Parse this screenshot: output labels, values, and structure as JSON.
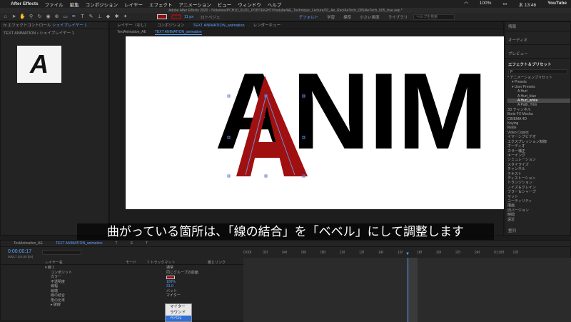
{
  "mac_menu": {
    "app": "After Effects",
    "items": [
      "ファイル",
      "編集",
      "コンポジション",
      "レイヤー",
      "エフェクト",
      "アニメーション",
      "ビュー",
      "ウィンドウ",
      "ヘルプ"
    ],
    "status": {
      "battery": "100%",
      "time": "木 13:46",
      "youtube": "YouTube"
    }
  },
  "window_title": "Adobe After Effects 2020 - /Volumes/PCH10_01/01_POBTEIGHT/Youtube/AE_Technique_Lecture/01_Ae_Rec/AeTech_005/AeTech_005_true.aep *",
  "toolbar": {
    "stroke_width": "11 px",
    "rotobrush_label": "ロトベジェ",
    "workspaces": [
      "デフォルト",
      "学習",
      "標準",
      "小さい画面",
      "ライブラリ"
    ],
    "active_workspace": "デフォルト",
    "search_placeholder": "ヘルプを検索"
  },
  "effect_controls": {
    "tab": "fx エフェクトコントロール",
    "tab_layer": "シェイプレイヤー 1",
    "subtitle": "TEXT ANIMATION • シェイプレイヤー 1",
    "thumb_letter": "A"
  },
  "comp_panel": {
    "tab_layer": "レイヤー（なし）",
    "tab_comp": "コンポジション",
    "comp_name": "TEXT ANIMATION_animation",
    "tab_render": "レンダーキュー",
    "subtab": "TextAnimation_AE",
    "subtab_active": "TEXT ANIMATION_animation",
    "canvas_text": "ANIM",
    "canvas_letter": "A"
  },
  "right_panel": {
    "sections": [
      "情報",
      "オーディオ",
      "プレビュー"
    ],
    "effects_header": "エフェクト＆プリセット",
    "search_value": "ρ",
    "tree": [
      "* アニメーションプリセット",
      "▾ Presets",
      "▾ User Presets",
      "A  Hurt",
      "A  Hurt_blue",
      "A  Hurt_white",
      "A  Path_Trim",
      "3D チャンネル",
      "Boris FX Mocha",
      "CINEMA 4D",
      "Keying",
      "Matte",
      "Video Copilot",
      "イマーシブビデオ",
      "エクスプレッション制御",
      "オーディオ",
      "カラー補正",
      "キーイング",
      "シミュレーション",
      "スタイライズ",
      "チャンネル",
      "テキスト",
      "ディストーション",
      "トランジション",
      "ノイズ＆グレイン",
      "ブラー＆シャープ",
      "マット",
      "ユーティリティ",
      "描画",
      "旧バージョン",
      "時間",
      "遠近"
    ],
    "selected_index": 5,
    "bottom_label": "整列"
  },
  "subtitle": "曲がっている箇所は、「線の結合」を「ベベル」にして調整します",
  "timeline": {
    "tabs": [
      "TextAnimation_AE",
      "TEXT ANIMATION_animation",
      "T",
      "S",
      "T"
    ],
    "timecode": "0:00:00:17",
    "timecode_sub": "00017 (24.00 fps)",
    "col_layer_name": "レイヤー名",
    "col_mode": "モード",
    "col_trackmatte": "T トラックマット",
    "col_parent": "親とリンク",
    "ruler": [
      "0:00f",
      "02f",
      "04f",
      "06f",
      "08f",
      "10f",
      "12f",
      "14f",
      "16f",
      "18f",
      "20f",
      "22f",
      "24f",
      "01:00f",
      "02f"
    ],
    "rows": [
      {
        "name": "▾ 線 1",
        "value": "通常"
      },
      {
        "name": "コンポジット",
        "value": "同じグループの前面"
      },
      {
        "name": "カラー",
        "value": ""
      },
      {
        "name": "不透明度",
        "value": "100%"
      },
      {
        "name": "線幅",
        "value": "31.0"
      },
      {
        "name": "線端",
        "value": "バット"
      },
      {
        "name": "線の結合",
        "value": "マイター"
      },
      {
        "name": "角の比率",
        "value": ""
      },
      {
        "name": "▸ 破線",
        "value": ""
      }
    ],
    "dropdown": [
      "マイター",
      "ラウンド",
      "ベベル"
    ],
    "dropdown_checked": 0,
    "playhead_frame": 17
  },
  "colors": {
    "accent": "#5ea0ff",
    "shape_red": "#a01010",
    "stroke_swatch": "#8b1010"
  }
}
